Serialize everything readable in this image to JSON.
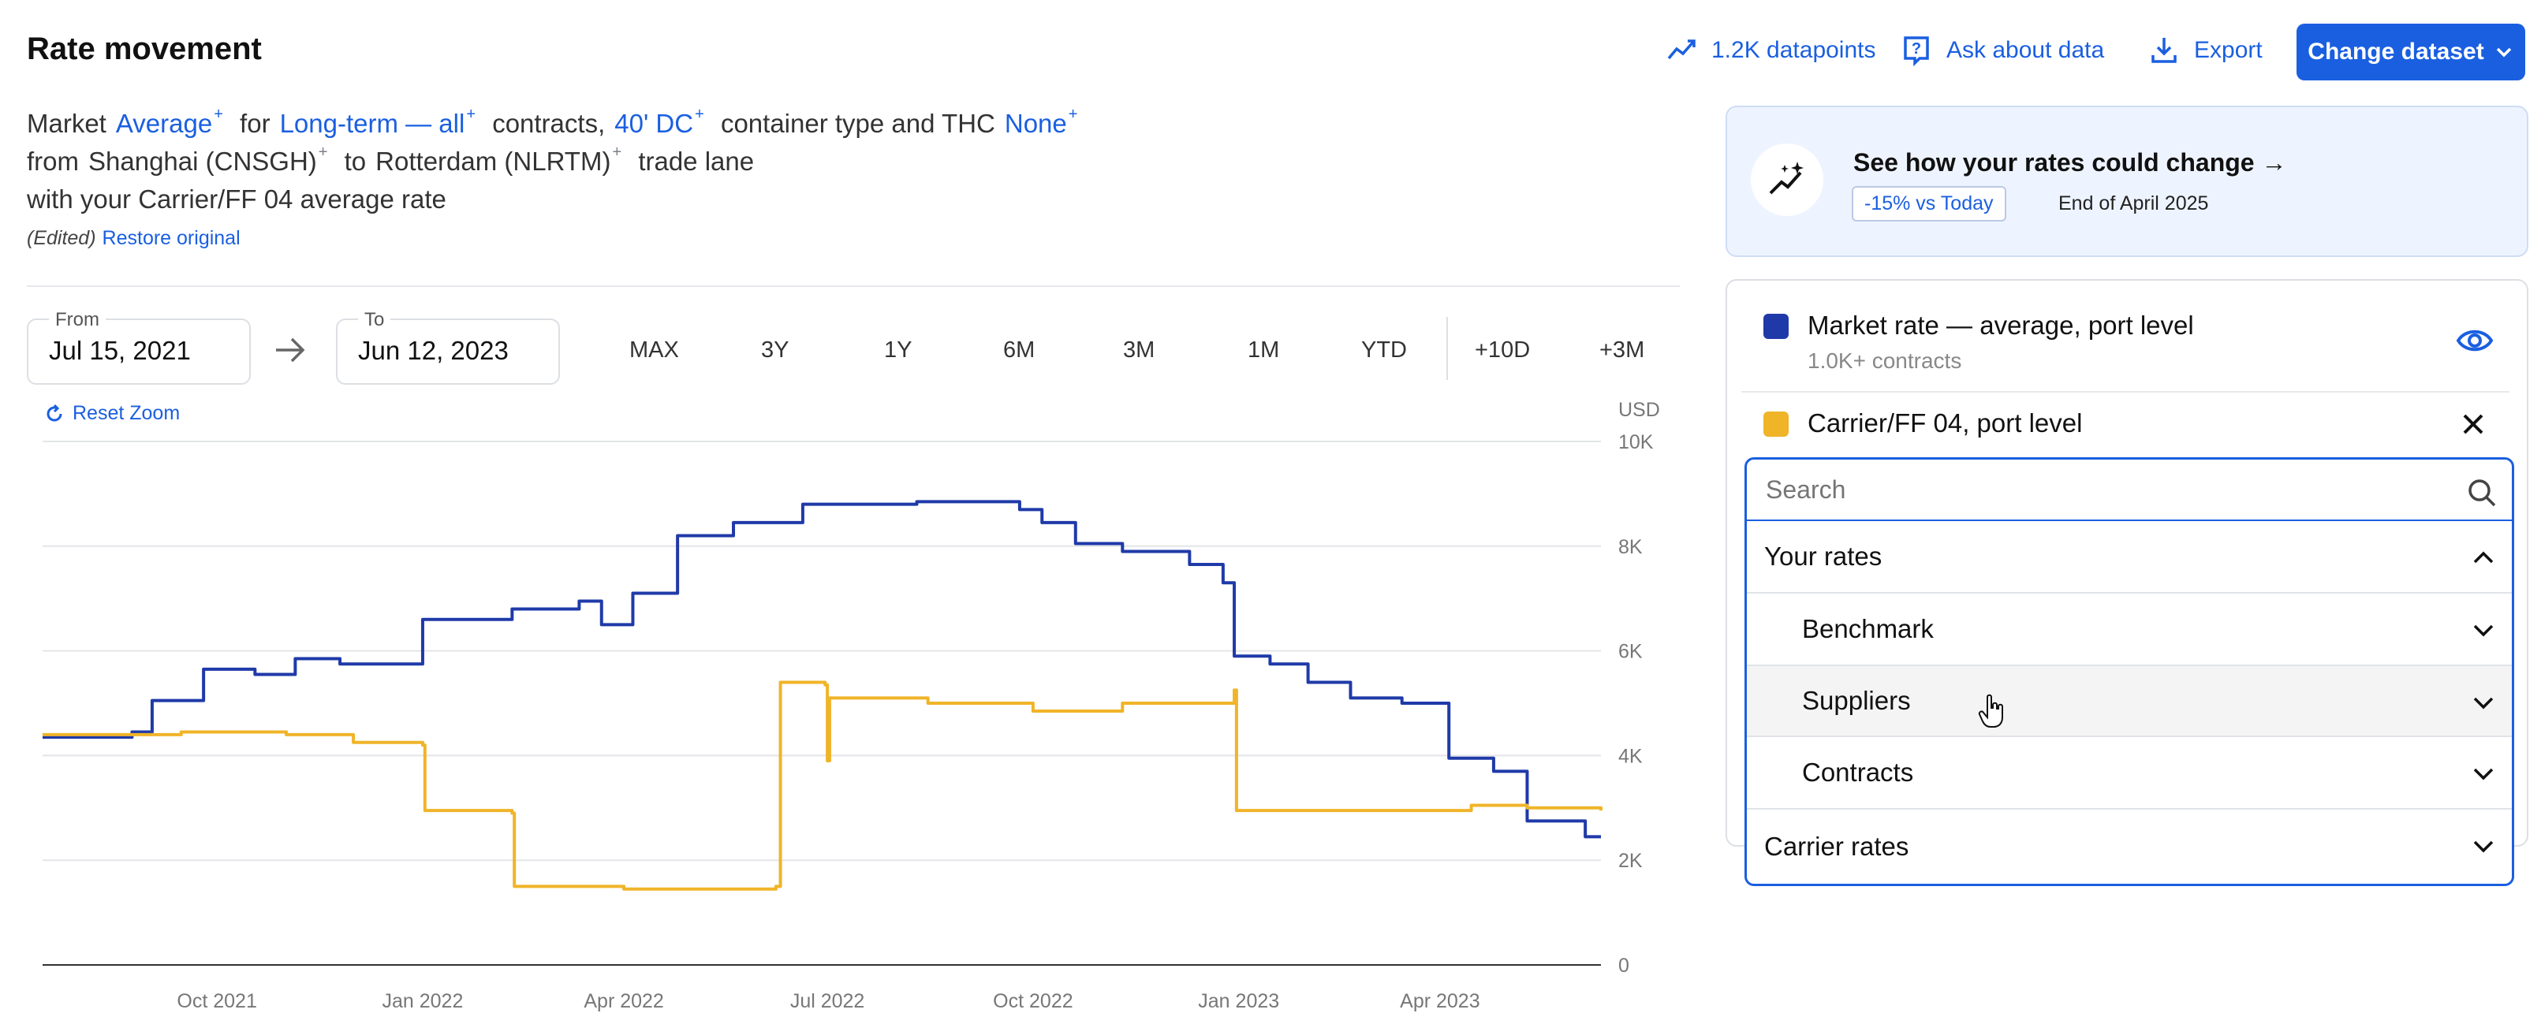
{
  "header": {
    "title": "Rate movement",
    "datapoints_label": "1.2K datapoints",
    "ask_label": "Ask about data",
    "export_label": "Export",
    "change_dataset_label": "Change dataset"
  },
  "description": {
    "market_word": "Market",
    "market_value": "Average",
    "for_word": "for",
    "contract_value": "Long-term — all",
    "contracts_word": "contracts,",
    "container_value": "40' DC",
    "container_text": "container type and THC",
    "thc_value": "None",
    "from_word": "from",
    "origin": "Shanghai (CNSGH)",
    "to_word": "to",
    "destination": "Rotterdam (NLRTM)",
    "trade_lane_word": "trade lane",
    "comparison_text": "with your Carrier/FF 04 average rate",
    "edited_label": "(Edited)",
    "restore_label": "Restore original",
    "plus": "+"
  },
  "date_range": {
    "from_label": "From",
    "from_value": "Jul 15, 2021",
    "to_label": "To",
    "to_value": "Jun 12, 2023",
    "ranges": [
      "MAX",
      "3Y",
      "1Y",
      "6M",
      "3M",
      "1M",
      "YTD"
    ],
    "forecasts": [
      "+10D",
      "+3M"
    ]
  },
  "reset_zoom_label": "Reset Zoom",
  "promo": {
    "title": "See how your rates could change →",
    "badge": "-15% vs Today",
    "date": "End of April 2025"
  },
  "legend": {
    "items": [
      {
        "title": "Market rate — average, port level",
        "sub": "1.0K+ contracts",
        "color": "#1f3aa8"
      },
      {
        "title": "Carrier/FF 04, port level",
        "color": "#f0b429"
      }
    ]
  },
  "dropdown": {
    "search_placeholder": "Search",
    "rows": [
      {
        "label": "Your rates",
        "expanded": true
      },
      {
        "label": "Benchmark"
      },
      {
        "label": "Suppliers"
      },
      {
        "label": "Contracts"
      },
      {
        "label": "Carrier rates"
      }
    ]
  },
  "colors": {
    "accent": "#1a5fe0",
    "market": "#1f3aa8",
    "carrier": "#f0b429"
  },
  "chart_data": {
    "type": "line",
    "ylabel": "USD",
    "y_ticks": [
      "10K",
      "8K",
      "6K",
      "4K",
      "2K",
      "0"
    ],
    "ylim": [
      0,
      10000
    ],
    "x_ticks": [
      "Oct 2021",
      "Jan 2022",
      "Apr 2022",
      "Jul 2022",
      "Oct 2022",
      "Jan 2023",
      "Apr 2023"
    ],
    "x_range": [
      "2021-07-15",
      "2023-06-12"
    ],
    "series": [
      {
        "name": "Market rate — average, port level",
        "color": "#1f3aa8",
        "points": [
          [
            "2021-07-15",
            4350
          ],
          [
            "2021-08-24",
            4450
          ],
          [
            "2021-09-02",
            5050
          ],
          [
            "2021-09-25",
            5650
          ],
          [
            "2021-10-18",
            5550
          ],
          [
            "2021-11-05",
            5850
          ],
          [
            "2021-11-25",
            5750
          ],
          [
            "2022-01-01",
            6600
          ],
          [
            "2022-02-10",
            6800
          ],
          [
            "2022-03-12",
            6950
          ],
          [
            "2022-03-22",
            6500
          ],
          [
            "2022-04-05",
            7100
          ],
          [
            "2022-04-25",
            8200
          ],
          [
            "2022-05-20",
            8450
          ],
          [
            "2022-06-20",
            8800
          ],
          [
            "2022-08-10",
            8850
          ],
          [
            "2022-09-25",
            8700
          ],
          [
            "2022-10-05",
            8450
          ],
          [
            "2022-10-20",
            8050
          ],
          [
            "2022-11-10",
            7900
          ],
          [
            "2022-12-10",
            7650
          ],
          [
            "2022-12-25",
            7300
          ],
          [
            "2022-12-30",
            5900
          ],
          [
            "2023-01-15",
            5750
          ],
          [
            "2023-02-01",
            5400
          ],
          [
            "2023-02-20",
            5100
          ],
          [
            "2023-03-15",
            5000
          ],
          [
            "2023-04-05",
            3950
          ],
          [
            "2023-04-25",
            3700
          ],
          [
            "2023-05-10",
            2750
          ],
          [
            "2023-06-05",
            2450
          ],
          [
            "2023-06-12",
            2450
          ]
        ]
      },
      {
        "name": "Carrier/FF 04, port level",
        "color": "#f0b429",
        "points": [
          [
            "2021-07-15",
            4400
          ],
          [
            "2021-09-15",
            4450
          ],
          [
            "2021-11-01",
            4400
          ],
          [
            "2021-12-01",
            4250
          ],
          [
            "2022-01-01",
            4200
          ],
          [
            "2022-01-02",
            2950
          ],
          [
            "2022-02-10",
            2900
          ],
          [
            "2022-02-11",
            1500
          ],
          [
            "2022-04-01",
            1450
          ],
          [
            "2022-06-08",
            1500
          ],
          [
            "2022-06-10",
            5400
          ],
          [
            "2022-06-30",
            5350
          ],
          [
            "2022-07-01",
            3900
          ],
          [
            "2022-07-02",
            5100
          ],
          [
            "2022-08-15",
            5000
          ],
          [
            "2022-10-01",
            4850
          ],
          [
            "2022-11-10",
            5000
          ],
          [
            "2022-12-30",
            5250
          ],
          [
            "2022-12-31",
            2950
          ],
          [
            "2023-02-15",
            2950
          ],
          [
            "2023-04-15",
            3050
          ],
          [
            "2023-05-10",
            3000
          ],
          [
            "2023-06-12",
            2950
          ]
        ]
      }
    ]
  }
}
